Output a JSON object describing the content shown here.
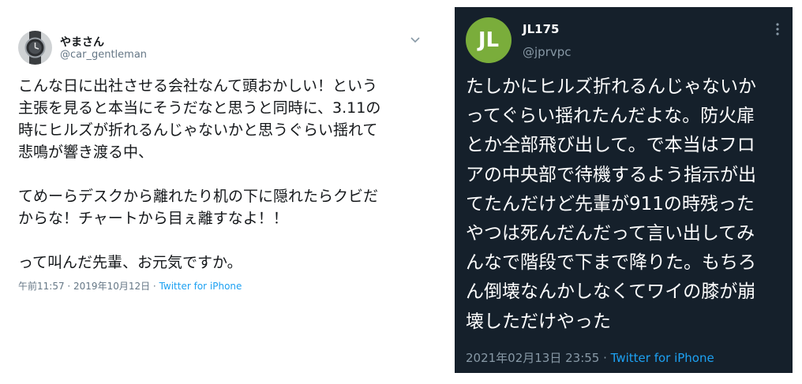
{
  "left_tweet": {
    "display_name": "やまさん",
    "handle": "@car_gentleman",
    "body_lines": [
      "こんな日に出社させる会社なんて頭おかしい！という",
      "主張を見ると本当にそうだなと思うと同時に、3.11の",
      "時にヒルズが折れるんじゃないかと思うぐらい揺れて",
      "悲鳴が響き渡る中、",
      "",
      "てめーらデスクから離れたり机の下に隠れたらクビだ",
      "からな！チャートから目ぇ離すなよ！！",
      "",
      "って叫んだ先輩、お元気ですか。"
    ],
    "timestamp": "午前11:57 · 2019年10月12日 · ",
    "source": "Twitter for iPhone",
    "menu_icon": "chevron-down-icon"
  },
  "right_tweet": {
    "avatar_initials": "JL",
    "avatar_color": "#7aad3b",
    "display_name": "JL175",
    "handle": "@jprvpc",
    "body_lines": [
      "たしかにヒルズ折れるんじゃないか",
      "ってぐらい揺れたんだよな。防火扉",
      "とか全部飛び出して。で本当はフロ",
      "アの中央部で待機するよう指示が出",
      "てたんだけど先輩が911の時残った",
      "やつは死んだんだって言い出してみ",
      "んなで階段で下まで降りた。もちろ",
      "ん倒壊なんかしなくてワイの膝が崩",
      "壊しただけやった"
    ],
    "timestamp": "2021年02月13日 23:55 · ",
    "source": "Twitter for iPhone",
    "menu_icon": "more-vertical-icon"
  },
  "colors": {
    "dark_background": "#15202b",
    "link_blue": "#1da1f2",
    "light_text": "#14171a",
    "muted_light": "#657786",
    "muted_dark": "#8899a6"
  }
}
